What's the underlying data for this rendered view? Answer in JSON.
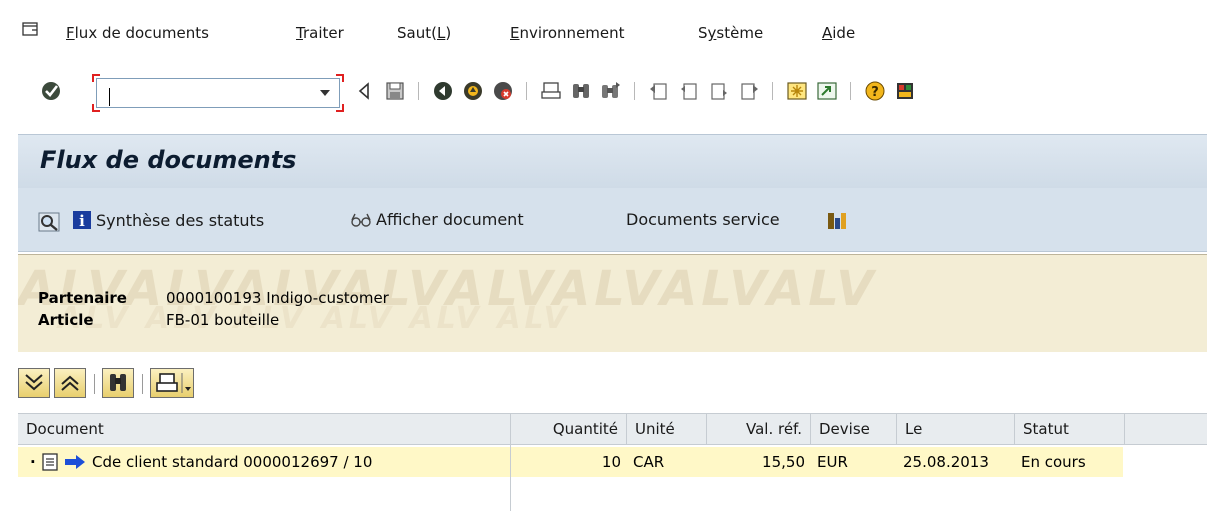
{
  "menu": {
    "items": [
      {
        "pre": "",
        "u": "F",
        "post": "lux de documents"
      },
      {
        "pre": "",
        "u": "T",
        "post": "raiter"
      },
      {
        "pre": "Saut(",
        "u": "L",
        "post": ")"
      },
      {
        "pre": "",
        "u": "E",
        "post": "nvironnement"
      },
      {
        "pre": "S",
        "u": "y",
        "post": "stème"
      },
      {
        "pre": "",
        "u": "A",
        "post": "ide"
      }
    ]
  },
  "toolbar": {
    "command_value": "",
    "icons": [
      "enter-icon",
      "back-triangle-icon",
      "save-icon",
      "back-icon",
      "exit-icon",
      "cancel-icon",
      "print-icon",
      "find-icon",
      "find-next-icon",
      "first-page-icon",
      "previous-page-icon",
      "next-page-icon",
      "last-page-icon",
      "create-session-icon",
      "shortcut-icon",
      "help-icon",
      "customize-layout-icon"
    ]
  },
  "title": "Flux de documents",
  "app_toolbar": {
    "status_overview": "Synthèse des statuts",
    "display_document": "Afficher document",
    "service_documents": "Documents service"
  },
  "header": {
    "watermark": "ALVALVALVALVALVALVALVALV",
    "watermark2": "ALV   ALV   ALV   ALV   ALV   ALV",
    "partner_label": "Partenaire",
    "partner_value": "0000100193 Indigo-customer",
    "article_label": "Article",
    "article_value": "FB-01 bouteille"
  },
  "grid": {
    "columns": {
      "document": "Document",
      "quantity": "Quantité",
      "unit": "Unité",
      "ref_value": "Val. réf.",
      "currency": "Devise",
      "date": "Le",
      "status": "Statut"
    },
    "rows": [
      {
        "document": "Cde client standard 0000012697 / 10",
        "quantity": "10",
        "unit": "CAR",
        "ref_value": "15,50",
        "currency": "EUR",
        "date": "25.08.2013",
        "status": "En cours"
      }
    ]
  },
  "colors": {
    "title_bg": "#d6e1ec",
    "header_bg": "#f3edd5",
    "row_highlight": "#fff8c7",
    "field_bracket": "#e02020"
  }
}
